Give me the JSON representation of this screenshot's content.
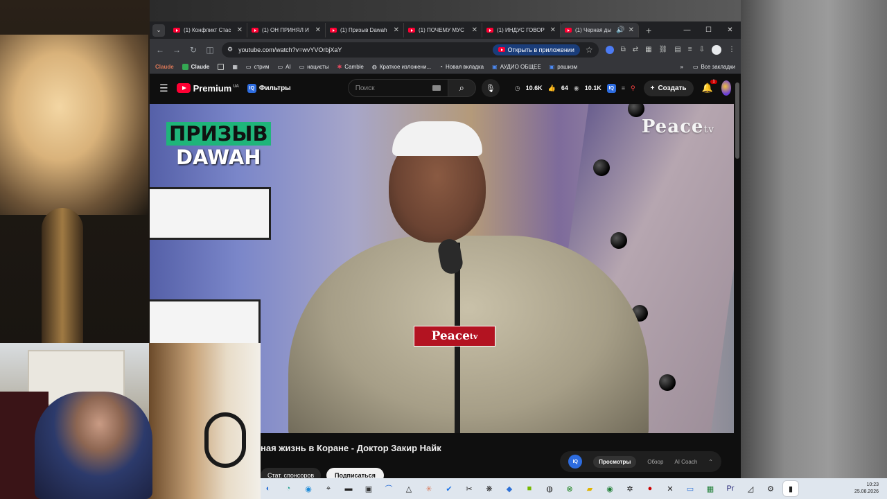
{
  "browser": {
    "tabs": [
      {
        "label": "(1) Конфликт Стас"
      },
      {
        "label": "(1) ОН ПРИНЯЛ И"
      },
      {
        "label": "(1) Призыв Dawah"
      },
      {
        "label": "(1) ПОЧЕМУ МУС"
      },
      {
        "label": "(1) ИНДУС ГОВОР"
      },
      {
        "label": "(1) Черная ды"
      }
    ],
    "url": "youtube.com/watch?v=wvYVOrbjXaY",
    "open_in_app": "Открыть в приложении",
    "bookmarks": [
      {
        "label": "Claude"
      },
      {
        "label": "Claude"
      },
      {
        "label": "стрим"
      },
      {
        "label": "AI"
      },
      {
        "label": "нацисты"
      },
      {
        "label": "Camble"
      },
      {
        "label": "Краткое изложени..."
      },
      {
        "label": "Новая вкладка"
      },
      {
        "label": "АУДИО ОБЩЕЕ"
      },
      {
        "label": "рашизм"
      }
    ],
    "all_bookmarks": "Все закладки"
  },
  "youtube": {
    "logo_text": "Premium",
    "region": "UA",
    "filters_label": "Фильтры",
    "search_placeholder": "Поиск",
    "stats": {
      "views": "10.6K",
      "likes": "64",
      "watch": "10.1K"
    },
    "create_label": "Создать",
    "notifications_count": "1"
  },
  "video": {
    "overlay_line1": "ПРИЗЫВ",
    "overlay_line2": "DAWAH",
    "channel_logo": "Peace",
    "channel_logo_suffix": "tv",
    "mic_label": "Peace",
    "mic_label_suffix": "tv",
    "title": "ная жизнь в Коране - Доктор Закир Найк",
    "subscribe_label": "Подписаться",
    "left_pill": "Стат. спонсоров"
  },
  "insight_panel": {
    "tabs": [
      {
        "label": "Просмотры",
        "active": true
      },
      {
        "label": "Обзор",
        "active": false
      },
      {
        "label": "AI Coach",
        "active": false
      }
    ]
  },
  "taskbar": {
    "time": "10:23",
    "date": "25.08.2026"
  }
}
